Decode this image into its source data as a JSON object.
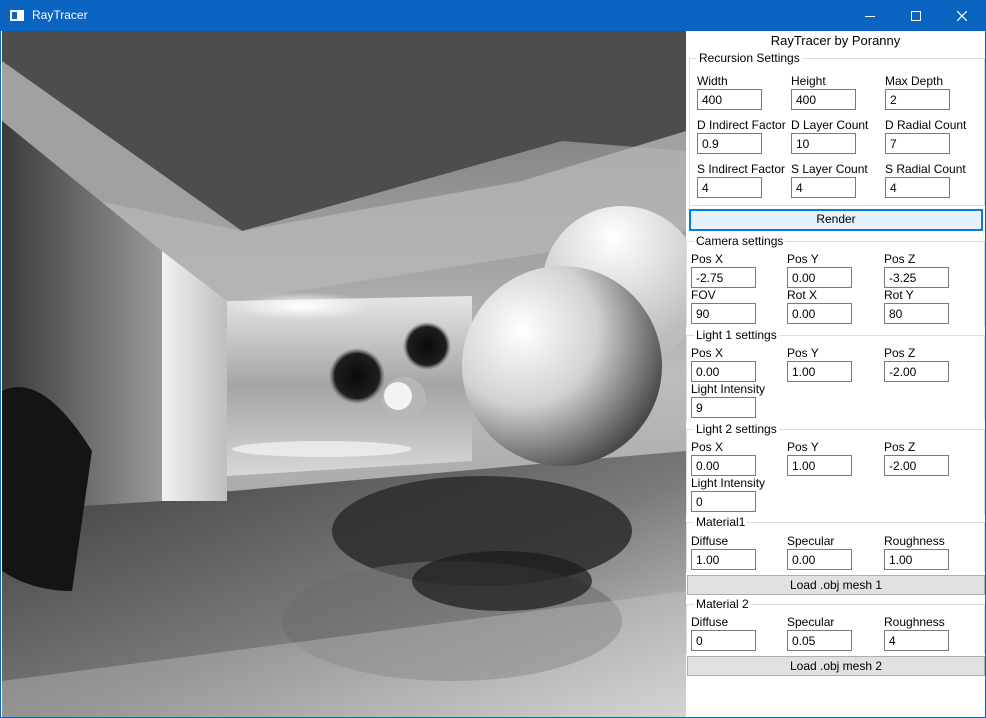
{
  "window": {
    "title": "RayTracer",
    "accent": "#0a64c0"
  },
  "panel": {
    "title": "RayTracer by Poranny",
    "recursion": {
      "legend": "Recursion Settings",
      "fields": [
        {
          "label": "Width",
          "value": "400"
        },
        {
          "label": "Height",
          "value": "400"
        },
        {
          "label": "Max Depth",
          "value": "2"
        },
        {
          "label": "D Indirect Factor",
          "value": "0.9"
        },
        {
          "label": "D Layer Count",
          "value": "10"
        },
        {
          "label": "D Radial Count",
          "value": "7"
        },
        {
          "label": "S Indirect Factor",
          "value": "4"
        },
        {
          "label": "S Layer Count",
          "value": "4"
        },
        {
          "label": "S Radial Count",
          "value": "4"
        }
      ]
    },
    "render_button": "Render",
    "camera": {
      "legend": "Camera settings",
      "fields": [
        {
          "label": "Pos X",
          "value": "-2.75"
        },
        {
          "label": "Pos Y",
          "value": "0.00"
        },
        {
          "label": "Pos Z",
          "value": "-3.25"
        },
        {
          "label": "FOV",
          "value": "90"
        },
        {
          "label": "Rot X",
          "value": "0.00"
        },
        {
          "label": "Rot Y",
          "value": "80"
        }
      ]
    },
    "light1": {
      "legend": "Light 1 settings",
      "fields": [
        {
          "label": "Pos X",
          "value": "0.00"
        },
        {
          "label": "Pos Y",
          "value": "1.00"
        },
        {
          "label": "Pos Z",
          "value": "-2.00"
        },
        {
          "label": "Light Intensity",
          "value": "9"
        }
      ]
    },
    "light2": {
      "legend": "Light 2 settings",
      "fields": [
        {
          "label": "Pos X",
          "value": "0.00"
        },
        {
          "label": "Pos Y",
          "value": "1.00"
        },
        {
          "label": "Pos Z",
          "value": "-2.00"
        },
        {
          "label": "Light Intensity",
          "value": "0"
        }
      ]
    },
    "material1": {
      "legend": "Material1",
      "fields": [
        {
          "label": "Diffuse",
          "value": "1.00"
        },
        {
          "label": "Specular",
          "value": "0.00"
        },
        {
          "label": "Roughness",
          "value": "1.00"
        }
      ],
      "load_button": "Load .obj mesh 1"
    },
    "material2": {
      "legend": "Material 2",
      "fields": [
        {
          "label": "Diffuse",
          "value": "0"
        },
        {
          "label": "Specular",
          "value": "0.05"
        },
        {
          "label": "Roughness",
          "value": "4"
        }
      ],
      "load_button": "Load .obj mesh 2"
    }
  }
}
